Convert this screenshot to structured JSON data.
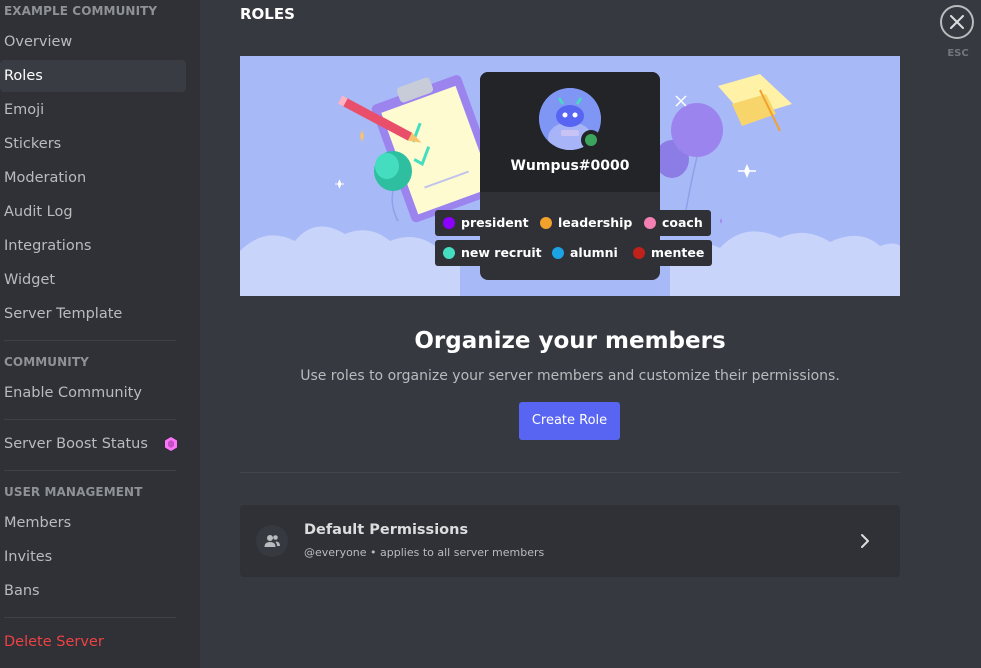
{
  "sidebar": {
    "sections": [
      {
        "header": "EXAMPLE COMMUNITY",
        "items": [
          "Overview",
          "Roles",
          "Emoji",
          "Stickers",
          "Moderation",
          "Audit Log",
          "Integrations",
          "Widget",
          "Server Template"
        ]
      },
      {
        "header": "COMMUNITY",
        "items": [
          "Enable Community"
        ]
      },
      {
        "header": "",
        "items": [
          "Server Boost Status"
        ]
      },
      {
        "header": "USER MANAGEMENT",
        "items": [
          "Members",
          "Invites",
          "Bans"
        ]
      },
      {
        "header": "",
        "items": [
          "Delete Server"
        ]
      }
    ],
    "selected": "Roles"
  },
  "main": {
    "title": "ROLES",
    "esc_label": "ESC",
    "banner": {
      "username": "Wumpus#0000",
      "roles": [
        {
          "name": "president",
          "color": "#8b00ff"
        },
        {
          "name": "leadership",
          "color": "#f2a12c"
        },
        {
          "name": "coach",
          "color": "#f47fb2"
        },
        {
          "name": "new recruit",
          "color": "#45ddc0"
        },
        {
          "name": "alumni",
          "color": "#1ba3e6"
        },
        {
          "name": "mentee",
          "color": "#c0211b"
        }
      ]
    },
    "headline": "Organize your members",
    "subline": "Use roles to organize your server members and customize their permissions.",
    "create_button": "Create Role",
    "default_permissions": {
      "title": "Default Permissions",
      "subtitle": "@everyone • applies to all server members"
    }
  },
  "colors": {
    "accent": "#5865f2",
    "danger": "#ed4245",
    "background": "#36393f",
    "sidebar": "#2f3136",
    "boost": "#ff73fa"
  }
}
